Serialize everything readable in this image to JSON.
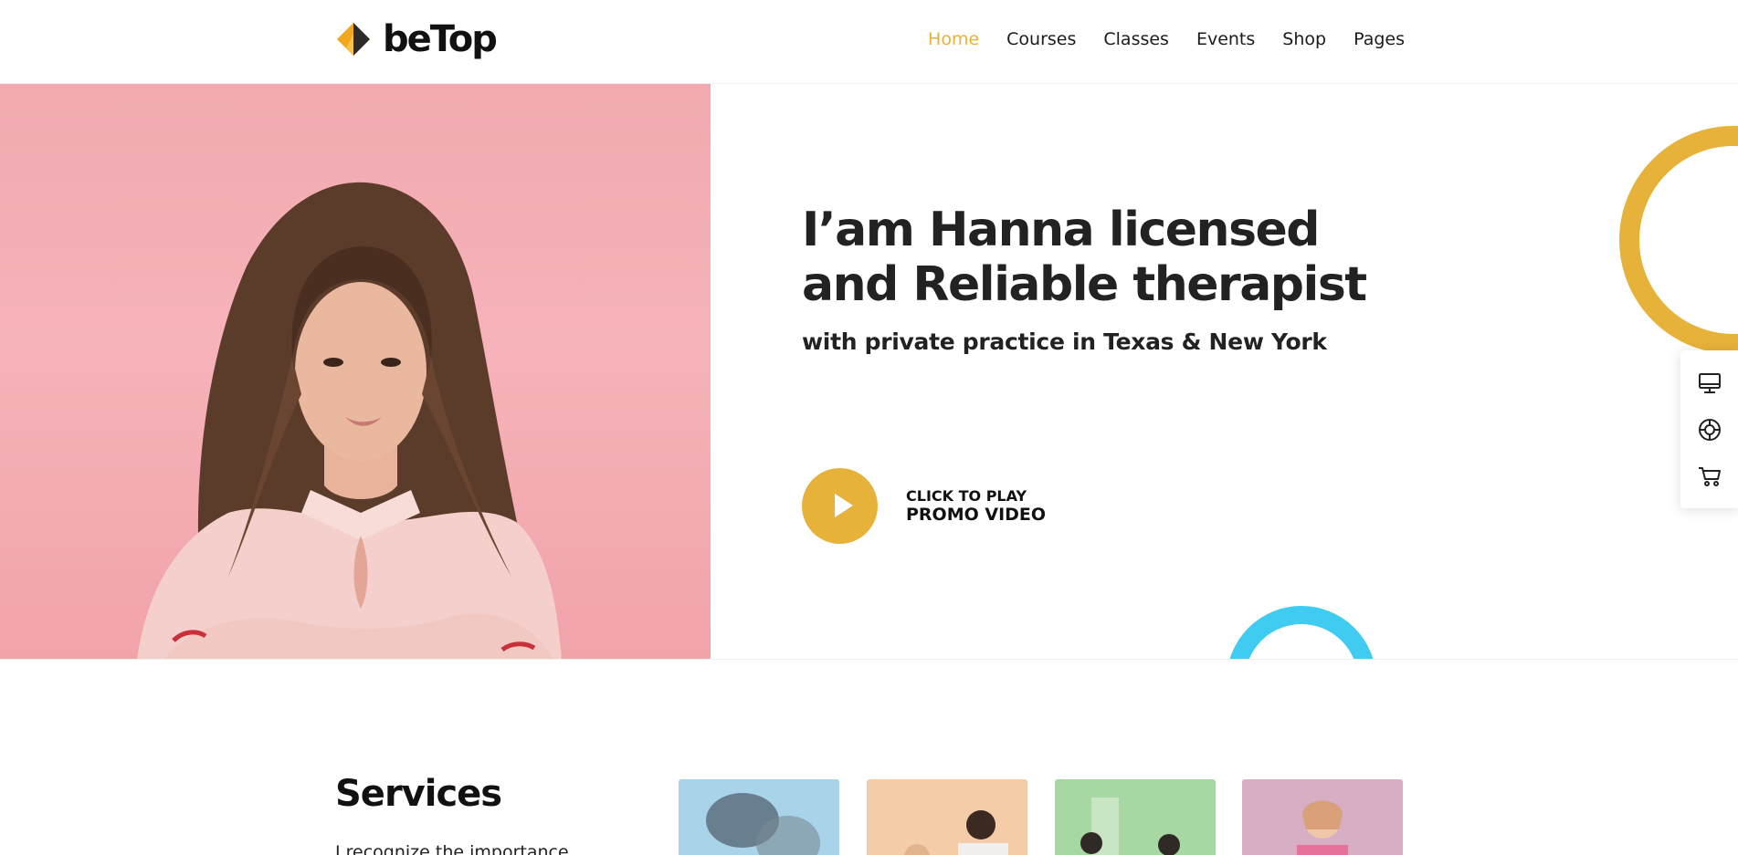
{
  "brand": {
    "name": "beTop",
    "colors": {
      "accent": "#e7b23a",
      "accent_blue": "#40cbf0",
      "text": "#1b1b1b",
      "hero_bg": "#f4adb3"
    }
  },
  "nav": {
    "items": [
      {
        "label": "Home",
        "active": true
      },
      {
        "label": "Courses",
        "active": false
      },
      {
        "label": "Classes",
        "active": false
      },
      {
        "label": "Events",
        "active": false
      },
      {
        "label": "Shop",
        "active": false
      },
      {
        "label": "Pages",
        "active": false
      }
    ]
  },
  "hero": {
    "title_line1": "I’am Hanna licensed",
    "title_line2": "and Reliable therapist",
    "subtitle": "with private practice in Texas & New York",
    "promo_small": "CLICK TO PLAY",
    "promo_big": "PROMO VIDEO",
    "photo_icon": "woman-portrait-image"
  },
  "side_panel": {
    "icons": [
      "monitor-icon",
      "lifebuoy-icon",
      "cart-icon"
    ]
  },
  "services": {
    "title": "Services",
    "text": "I recognize the importance",
    "cards": [
      "service-image-1",
      "service-image-2",
      "service-image-3",
      "service-image-4"
    ]
  }
}
